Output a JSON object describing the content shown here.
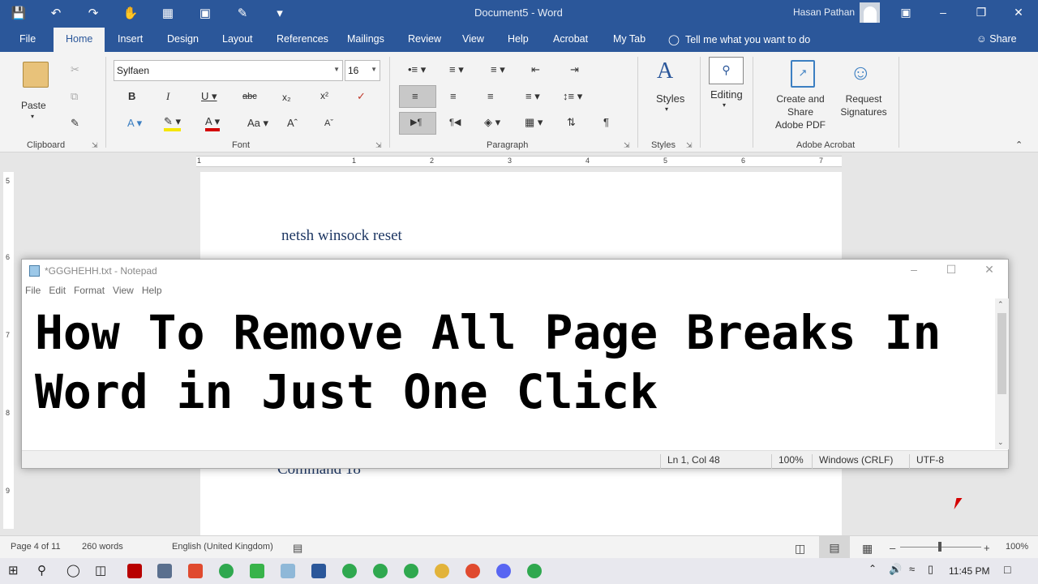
{
  "word": {
    "title": "Document5  -  Word",
    "user": "Hasan Pathan",
    "tabs": [
      "File",
      "Home",
      "Insert",
      "Design",
      "Layout",
      "References",
      "Mailings",
      "Review",
      "View",
      "Help",
      "Acrobat",
      "My Tab"
    ],
    "tell_me": "Tell me what you want to do",
    "share": "Share",
    "ribbon": {
      "paste": "Paste",
      "font_name": "Sylfaen",
      "font_size": "16",
      "styles": "Styles",
      "editing": "Editing",
      "create_share_pdf_line1": "Create and Share",
      "create_share_pdf_line2": "Adobe PDF",
      "request_sig_line1": "Request",
      "request_sig_line2": "Signatures",
      "groups": {
        "clipboard": "Clipboard",
        "font": "Font",
        "paragraph": "Paragraph",
        "styles": "Styles",
        "adobe_acrobat": "Adobe Acrobat"
      }
    },
    "ruler_numbers": [
      "1",
      "1",
      "2",
      "3",
      "4",
      "5",
      "6",
      "7"
    ],
    "vruler_numbers": [
      "5",
      "6",
      "7",
      "8",
      "9"
    ],
    "document": {
      "line1": "netsh winsock reset",
      "line2": "Command 18"
    },
    "status": {
      "page": "Page 4 of 11",
      "words": "260 words",
      "language": "English (United Kingdom)",
      "zoom": "100%"
    }
  },
  "notepad": {
    "title": "*GGGHEHH.txt - Notepad",
    "menu": [
      "File",
      "Edit",
      "Format",
      "View",
      "Help"
    ],
    "text_line1": "How To Remove All Page Breaks In",
    "text_line2": "Word in Just One Click",
    "status": {
      "position": "Ln 1, Col 48",
      "zoom": "100%",
      "line_ending": "Windows (CRLF)",
      "encoding": "UTF-8"
    }
  },
  "taskbar": {
    "clock": "11:45 PM"
  },
  "colors": {
    "word_blue": "#2b579a",
    "doc_text": "#1f3864"
  }
}
